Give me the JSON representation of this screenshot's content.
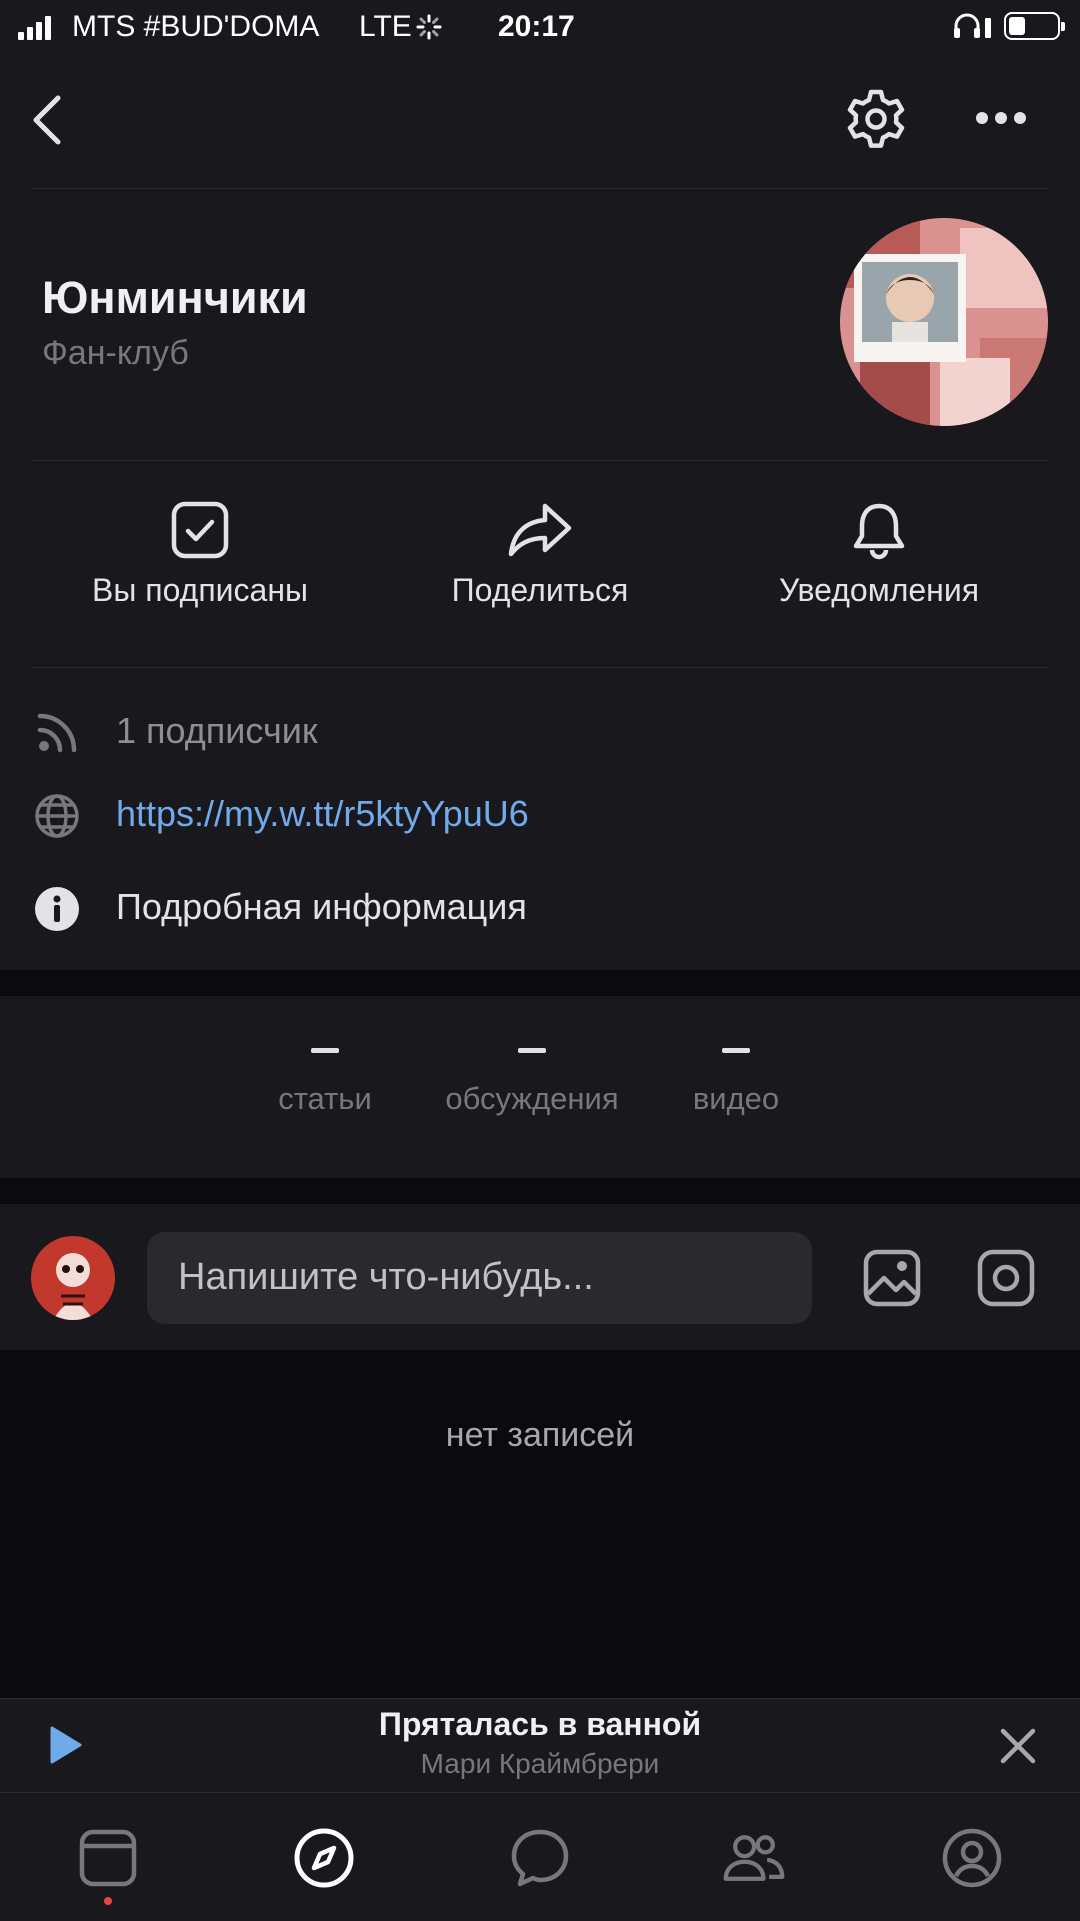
{
  "status_bar": {
    "carrier": "MTS #BUD'DOMA",
    "network": "LTE",
    "time": "20:17"
  },
  "header": {
    "back_icon": "chevron-left-icon",
    "settings_icon": "gear-icon",
    "more_icon": "more-horizontal-icon"
  },
  "community": {
    "name": "Юнминчики",
    "type": "Фан-клуб"
  },
  "actions": [
    {
      "label": "Вы подписаны",
      "icon": "checkbox-checked-icon"
    },
    {
      "label": "Поделиться",
      "icon": "share-arrow-icon"
    },
    {
      "label": "Уведомления",
      "icon": "bell-icon"
    }
  ],
  "info": {
    "subscribers": "1 подписчик",
    "link": "https://my.w.tt/r5ktyYpuU6",
    "details": "Подробная информация"
  },
  "counters": [
    {
      "value": "–",
      "label": "статьи"
    },
    {
      "value": "–",
      "label": "обсуждения"
    },
    {
      "value": "–",
      "label": "видео"
    }
  ],
  "composer": {
    "placeholder": "Напишите что-нибудь..."
  },
  "feed": {
    "empty_text": "нет записей"
  },
  "player": {
    "title": "Пряталась в ванной",
    "artist": "Мари Краймбрери"
  },
  "tabs": [
    {
      "icon": "feed-icon"
    },
    {
      "icon": "compass-icon",
      "active": true
    },
    {
      "icon": "chat-icon"
    },
    {
      "icon": "friends-icon"
    },
    {
      "icon": "profile-icon"
    }
  ],
  "colors": {
    "background": "#0b0a0e",
    "card": "#19191d",
    "link": "#71aaeb",
    "accent": "#71aaeb",
    "text_secondary": "#76787a",
    "notification_dot": "#e64646"
  }
}
